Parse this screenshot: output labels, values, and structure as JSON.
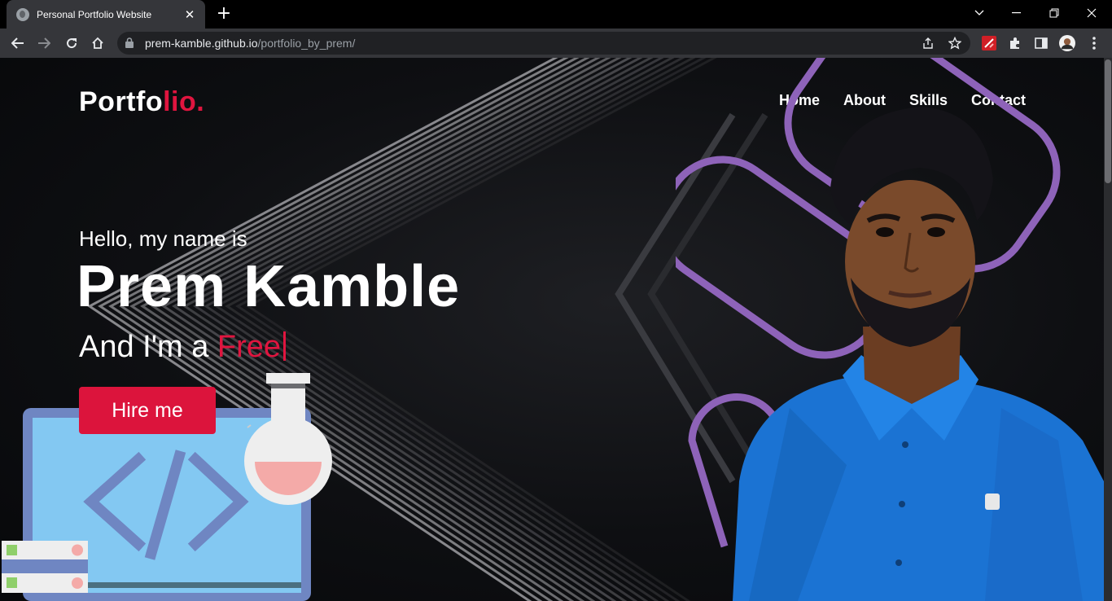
{
  "browser": {
    "tab_title": "Personal Portfolio Website",
    "url_domain": "prem-kamble.github.io",
    "url_path": "/portfolio_by_prem/",
    "icons": [
      "globe-icon",
      "close-icon",
      "plus-icon",
      "chevron-down-icon",
      "minimize-icon",
      "restore-icon",
      "close-window-icon",
      "back-icon",
      "forward-icon",
      "reload-icon",
      "home-icon",
      "lock-icon",
      "share-icon",
      "star-icon",
      "extension-icon",
      "puzzle-icon",
      "side-panel-icon",
      "profile-avatar",
      "more-icon"
    ]
  },
  "site": {
    "logo_main": "Portfo",
    "logo_accent": "lio.",
    "nav": [
      "Home",
      "About",
      "Skills",
      "Contact"
    ],
    "hello": "Hello, my name is",
    "name": "Prem Kamble",
    "role_prefix": "And I'm a ",
    "role_typed": "Free",
    "hire_button": "Hire me",
    "accent_color": "#dc143c",
    "outline_color": "#8e63b9"
  }
}
